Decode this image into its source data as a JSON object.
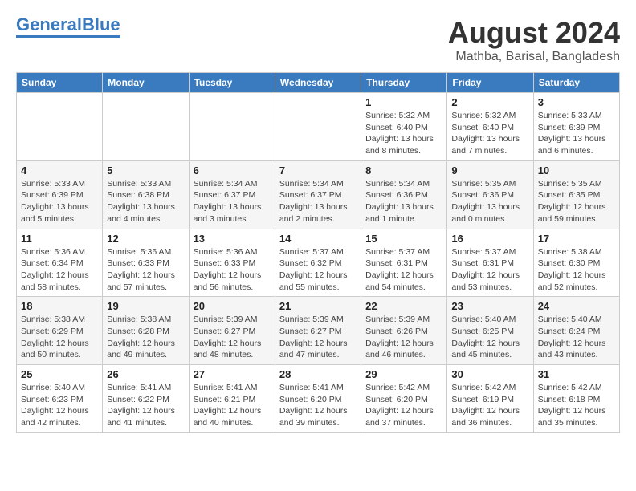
{
  "logo": {
    "part1": "General",
    "part2": "Blue"
  },
  "title": {
    "month_year": "August 2024",
    "location": "Mathba, Barisal, Bangladesh"
  },
  "days_of_week": [
    "Sunday",
    "Monday",
    "Tuesday",
    "Wednesday",
    "Thursday",
    "Friday",
    "Saturday"
  ],
  "weeks": [
    [
      {
        "day": "",
        "info": ""
      },
      {
        "day": "",
        "info": ""
      },
      {
        "day": "",
        "info": ""
      },
      {
        "day": "",
        "info": ""
      },
      {
        "day": "1",
        "info": "Sunrise: 5:32 AM\nSunset: 6:40 PM\nDaylight: 13 hours and 8 minutes."
      },
      {
        "day": "2",
        "info": "Sunrise: 5:32 AM\nSunset: 6:40 PM\nDaylight: 13 hours and 7 minutes."
      },
      {
        "day": "3",
        "info": "Sunrise: 5:33 AM\nSunset: 6:39 PM\nDaylight: 13 hours and 6 minutes."
      }
    ],
    [
      {
        "day": "4",
        "info": "Sunrise: 5:33 AM\nSunset: 6:39 PM\nDaylight: 13 hours and 5 minutes."
      },
      {
        "day": "5",
        "info": "Sunrise: 5:33 AM\nSunset: 6:38 PM\nDaylight: 13 hours and 4 minutes."
      },
      {
        "day": "6",
        "info": "Sunrise: 5:34 AM\nSunset: 6:37 PM\nDaylight: 13 hours and 3 minutes."
      },
      {
        "day": "7",
        "info": "Sunrise: 5:34 AM\nSunset: 6:37 PM\nDaylight: 13 hours and 2 minutes."
      },
      {
        "day": "8",
        "info": "Sunrise: 5:34 AM\nSunset: 6:36 PM\nDaylight: 13 hours and 1 minute."
      },
      {
        "day": "9",
        "info": "Sunrise: 5:35 AM\nSunset: 6:36 PM\nDaylight: 13 hours and 0 minutes."
      },
      {
        "day": "10",
        "info": "Sunrise: 5:35 AM\nSunset: 6:35 PM\nDaylight: 12 hours and 59 minutes."
      }
    ],
    [
      {
        "day": "11",
        "info": "Sunrise: 5:36 AM\nSunset: 6:34 PM\nDaylight: 12 hours and 58 minutes."
      },
      {
        "day": "12",
        "info": "Sunrise: 5:36 AM\nSunset: 6:33 PM\nDaylight: 12 hours and 57 minutes."
      },
      {
        "day": "13",
        "info": "Sunrise: 5:36 AM\nSunset: 6:33 PM\nDaylight: 12 hours and 56 minutes."
      },
      {
        "day": "14",
        "info": "Sunrise: 5:37 AM\nSunset: 6:32 PM\nDaylight: 12 hours and 55 minutes."
      },
      {
        "day": "15",
        "info": "Sunrise: 5:37 AM\nSunset: 6:31 PM\nDaylight: 12 hours and 54 minutes."
      },
      {
        "day": "16",
        "info": "Sunrise: 5:37 AM\nSunset: 6:31 PM\nDaylight: 12 hours and 53 minutes."
      },
      {
        "day": "17",
        "info": "Sunrise: 5:38 AM\nSunset: 6:30 PM\nDaylight: 12 hours and 52 minutes."
      }
    ],
    [
      {
        "day": "18",
        "info": "Sunrise: 5:38 AM\nSunset: 6:29 PM\nDaylight: 12 hours and 50 minutes."
      },
      {
        "day": "19",
        "info": "Sunrise: 5:38 AM\nSunset: 6:28 PM\nDaylight: 12 hours and 49 minutes."
      },
      {
        "day": "20",
        "info": "Sunrise: 5:39 AM\nSunset: 6:27 PM\nDaylight: 12 hours and 48 minutes."
      },
      {
        "day": "21",
        "info": "Sunrise: 5:39 AM\nSunset: 6:27 PM\nDaylight: 12 hours and 47 minutes."
      },
      {
        "day": "22",
        "info": "Sunrise: 5:39 AM\nSunset: 6:26 PM\nDaylight: 12 hours and 46 minutes."
      },
      {
        "day": "23",
        "info": "Sunrise: 5:40 AM\nSunset: 6:25 PM\nDaylight: 12 hours and 45 minutes."
      },
      {
        "day": "24",
        "info": "Sunrise: 5:40 AM\nSunset: 6:24 PM\nDaylight: 12 hours and 43 minutes."
      }
    ],
    [
      {
        "day": "25",
        "info": "Sunrise: 5:40 AM\nSunset: 6:23 PM\nDaylight: 12 hours and 42 minutes."
      },
      {
        "day": "26",
        "info": "Sunrise: 5:41 AM\nSunset: 6:22 PM\nDaylight: 12 hours and 41 minutes."
      },
      {
        "day": "27",
        "info": "Sunrise: 5:41 AM\nSunset: 6:21 PM\nDaylight: 12 hours and 40 minutes."
      },
      {
        "day": "28",
        "info": "Sunrise: 5:41 AM\nSunset: 6:20 PM\nDaylight: 12 hours and 39 minutes."
      },
      {
        "day": "29",
        "info": "Sunrise: 5:42 AM\nSunset: 6:20 PM\nDaylight: 12 hours and 37 minutes."
      },
      {
        "day": "30",
        "info": "Sunrise: 5:42 AM\nSunset: 6:19 PM\nDaylight: 12 hours and 36 minutes."
      },
      {
        "day": "31",
        "info": "Sunrise: 5:42 AM\nSunset: 6:18 PM\nDaylight: 12 hours and 35 minutes."
      }
    ]
  ]
}
